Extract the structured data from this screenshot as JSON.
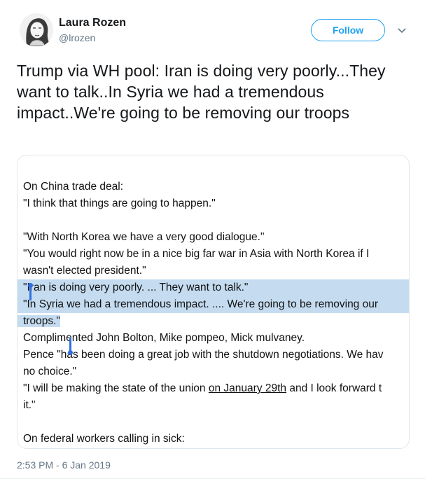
{
  "author": {
    "name": "Laura Rozen",
    "handle": "@lrozen"
  },
  "actions": {
    "follow_label": "Follow"
  },
  "tweet": {
    "text": "Trump via WH pool: Iran is doing very poorly...They want to talk..In Syria we had a tremendous impact..We're going to be removing our troops",
    "timestamp": "2:53 PM - 6 Jan 2019"
  },
  "screenshot": {
    "lines": [
      "On China trade deal:",
      "\"I think that things are going to happen.\"",
      "",
      "\"With North Korea we have a very good dialogue.\"",
      "\"You would right now be in a nice big far war in Asia with North Korea if I",
      "wasn't elected president.\"",
      "\"Iran is doing very poorly. ... They want to talk.\"",
      "\"In Syria we had a tremendous impact. .... We're going to be removing our",
      "troops.\"",
      "Complimented John Bolton, Mike pompeo, Mick mulvaney.",
      "Pence \"has been doing a great job with the shutdown negotiations. We hav",
      "no choice.\"",
      "\"I will be making the state of the union ",
      "it.\"",
      "",
      "On federal workers calling in sick:"
    ],
    "sotu_date": "on January 29th",
    "sotu_tail": " and I look forward t"
  },
  "colors": {
    "accent": "#1da1f2",
    "selection": "#c5dcf0",
    "cursor": "#2f6fe0",
    "muted": "#657786"
  },
  "icons": {
    "caret": "chevron-down-icon",
    "avatar": "avatar-sketch"
  }
}
